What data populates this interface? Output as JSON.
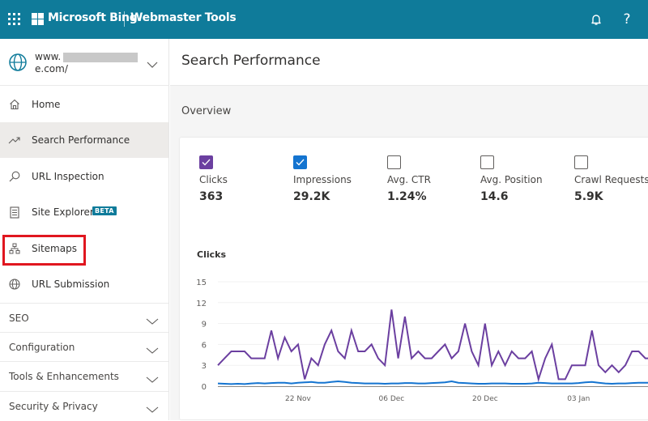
{
  "topbar": {
    "brand": "Microsoft Bing",
    "product": "Webmaster Tools",
    "icons": [
      "app-launcher-icon",
      "microsoft-logo-icon",
      "bell-icon",
      "help-icon"
    ],
    "help_glyph": "?"
  },
  "site": {
    "url_line1": "www.",
    "url_line2": "e.com/"
  },
  "sidebar": {
    "items": [
      {
        "label": "Home",
        "icon": "home-icon"
      },
      {
        "label": "Search Performance",
        "icon": "trend-icon",
        "active": true
      },
      {
        "label": "URL Inspection",
        "icon": "search-icon"
      },
      {
        "label": "Site Explorer",
        "icon": "document-list-icon",
        "badge": "BETA"
      },
      {
        "label": "Sitemaps",
        "icon": "sitemap-icon",
        "highlighted": true
      },
      {
        "label": "URL Submission",
        "icon": "globe-icon"
      }
    ],
    "sections": [
      {
        "label": "SEO"
      },
      {
        "label": "Configuration"
      },
      {
        "label": "Tools & Enhancements"
      },
      {
        "label": "Security & Privacy"
      }
    ],
    "highlight_color": "#e0161f"
  },
  "main": {
    "page_title": "Search Performance",
    "overview_title": "Overview",
    "metrics": [
      {
        "label": "Clicks",
        "value": "363",
        "checked": true,
        "color": "#6b3fa0"
      },
      {
        "label": "Impressions",
        "value": "29.2K",
        "checked": true,
        "color": "#1474d0"
      },
      {
        "label": "Avg. CTR",
        "value": "1.24%",
        "checked": false
      },
      {
        "label": "Avg. Position",
        "value": "14.6",
        "checked": false
      },
      {
        "label": "Crawl Requests",
        "value": "5.9K",
        "checked": false
      }
    ],
    "chart_title": "Clicks"
  },
  "colors": {
    "brand": "#0f7b9a",
    "clicks": "#6b3fa0",
    "impressions": "#1474d0"
  },
  "chart_data": {
    "type": "line",
    "title": "Clicks",
    "xlabel": "",
    "ylabel": "",
    "ylim": [
      0,
      15
    ],
    "yticks": [
      0,
      3,
      6,
      9,
      12,
      15
    ],
    "xtick_labels": [
      {
        "label": "22 Nov",
        "index": 12
      },
      {
        "label": "06 Dec",
        "index": 26
      },
      {
        "label": "20 Dec",
        "index": 40
      },
      {
        "label": "03 Jan",
        "index": 54
      }
    ],
    "grid": true,
    "series": [
      {
        "name": "Clicks",
        "color": "#6b3fa0",
        "values": [
          3,
          4,
          5,
          5,
          5,
          4,
          4,
          4,
          8,
          4,
          7,
          5,
          6,
          1,
          4,
          3,
          6,
          8,
          5,
          4,
          8,
          5,
          5,
          6,
          4,
          3,
          11,
          4,
          10,
          4,
          5,
          4,
          4,
          5,
          6,
          4,
          5,
          9,
          5,
          3,
          9,
          3,
          5,
          3,
          5,
          4,
          4,
          5,
          1,
          4,
          6,
          1,
          1,
          3,
          3,
          3,
          8,
          3,
          2,
          3,
          2,
          3,
          5,
          5,
          4,
          4
        ]
      },
      {
        "name": "Impressions (scaled)",
        "color": "#1474d0",
        "values": [
          0.4,
          0.35,
          0.3,
          0.35,
          0.3,
          0.4,
          0.45,
          0.4,
          0.45,
          0.5,
          0.5,
          0.4,
          0.5,
          0.55,
          0.6,
          0.5,
          0.5,
          0.6,
          0.7,
          0.6,
          0.5,
          0.45,
          0.4,
          0.4,
          0.4,
          0.35,
          0.4,
          0.4,
          0.45,
          0.45,
          0.4,
          0.4,
          0.45,
          0.5,
          0.55,
          0.7,
          0.5,
          0.45,
          0.4,
          0.35,
          0.35,
          0.4,
          0.4,
          0.4,
          0.35,
          0.35,
          0.35,
          0.4,
          0.5,
          0.45,
          0.4,
          0.4,
          0.4,
          0.4,
          0.45,
          0.55,
          0.6,
          0.5,
          0.4,
          0.35,
          0.4,
          0.4,
          0.45,
          0.5,
          0.5,
          0.5
        ]
      }
    ]
  }
}
